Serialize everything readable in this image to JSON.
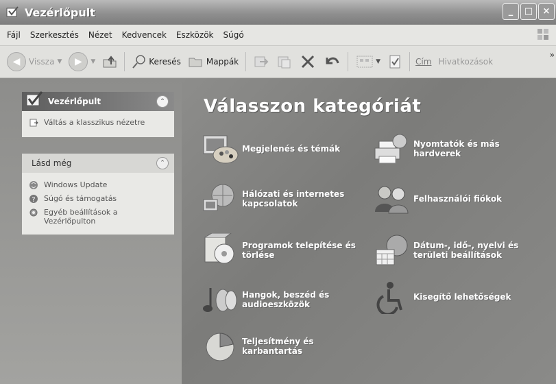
{
  "window": {
    "title": "Vezérlőpult"
  },
  "menu": [
    "Fájl",
    "Szerkesztés",
    "Nézet",
    "Kedvencek",
    "Eszközök",
    "Súgó"
  ],
  "toolbar": {
    "back_label": "Vissza",
    "search_label": "Keresés",
    "folders_label": "Mappák",
    "address_label": "Cím",
    "links_label": "Hivatkozások",
    "more": "»"
  },
  "sidebar": {
    "panel_title": "Vezérlőpult",
    "switch_view": "Váltás a klasszikus nézetre",
    "see_also_title": "Lásd még",
    "see_also_items": [
      {
        "label": "Windows Update",
        "icon": "windows-update-icon"
      },
      {
        "label": "Súgó és támogatás",
        "icon": "help-icon"
      },
      {
        "label": "Egyéb beállítások a Vezérlőpulton",
        "icon": "settings-icon"
      }
    ]
  },
  "main": {
    "heading": "Válasszon kategóriát",
    "categories": [
      {
        "label": "Megjelenés és témák",
        "icon": "appearance-icon"
      },
      {
        "label": "Nyomtatók és más hardverek",
        "icon": "printer-icon"
      },
      {
        "label": "Hálózati és internetes kapcsolatok",
        "icon": "network-icon"
      },
      {
        "label": "Felhasználói fiókok",
        "icon": "user-accounts-icon"
      },
      {
        "label": "Programok telepítése és törlése",
        "icon": "add-remove-programs-icon"
      },
      {
        "label": "Dátum-, idő-, nyelvi és területi beállítások",
        "icon": "date-time-icon"
      },
      {
        "label": "Hangok, beszéd és audioeszközök",
        "icon": "sound-icon"
      },
      {
        "label": "Kisegítő lehetőségek",
        "icon": "accessibility-icon"
      },
      {
        "label": "Teljesítmény és karbantartás",
        "icon": "performance-icon"
      }
    ]
  }
}
